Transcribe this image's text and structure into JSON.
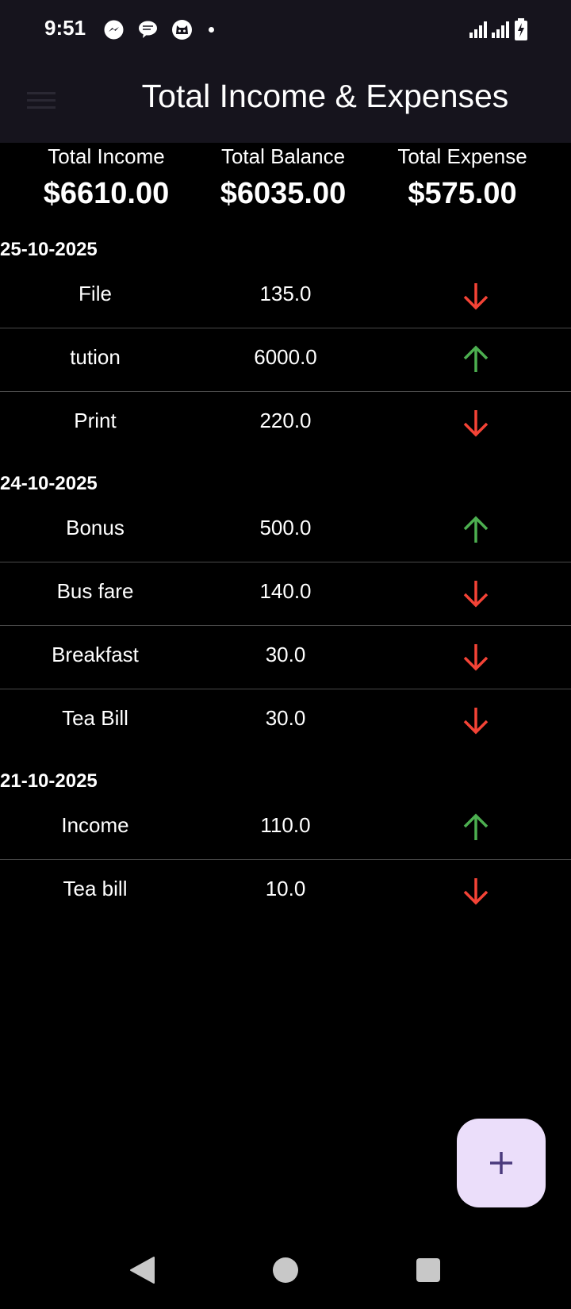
{
  "status_bar": {
    "time": "9:51",
    "notification_icons": [
      "messenger-icon",
      "chat-bubble-icon",
      "cat-face-icon",
      "more-dot-icon"
    ],
    "right_icons": [
      "signal-icon",
      "signal-icon",
      "battery-charging-icon"
    ]
  },
  "app_bar": {
    "title": "Total Income & Expenses",
    "menu_icon": "hamburger-menu-icon"
  },
  "summary": {
    "income_label": "Total Income",
    "income_value": "$6610.00",
    "balance_label": "Total Balance",
    "balance_value": "$6035.00",
    "expense_label": "Total Expense",
    "expense_value": "$575.00"
  },
  "colors": {
    "income_arrow": "#4caf50",
    "expense_arrow": "#f44336",
    "fab_background": "#ebdefa"
  },
  "groups": [
    {
      "date": "25-10-2025",
      "items": [
        {
          "name": "File",
          "amount": "135.0",
          "type": "expense"
        },
        {
          "name": "tution",
          "amount": "6000.0",
          "type": "income"
        },
        {
          "name": "Print",
          "amount": "220.0",
          "type": "expense"
        }
      ]
    },
    {
      "date": "24-10-2025",
      "items": [
        {
          "name": "Bonus",
          "amount": "500.0",
          "type": "income"
        },
        {
          "name": "Bus fare",
          "amount": "140.0",
          "type": "expense"
        },
        {
          "name": "Breakfast",
          "amount": "30.0",
          "type": "expense"
        },
        {
          "name": "Tea Bill",
          "amount": "30.0",
          "type": "expense"
        }
      ]
    },
    {
      "date": "21-10-2025",
      "items": [
        {
          "name": "Income",
          "amount": "110.0",
          "type": "income"
        },
        {
          "name": "Tea bill",
          "amount": "10.0",
          "type": "expense"
        }
      ]
    }
  ],
  "fab": {
    "label": "+",
    "icon": "add-icon"
  },
  "nav_bar": {
    "icons": [
      "back-icon",
      "home-icon",
      "recents-icon"
    ]
  }
}
